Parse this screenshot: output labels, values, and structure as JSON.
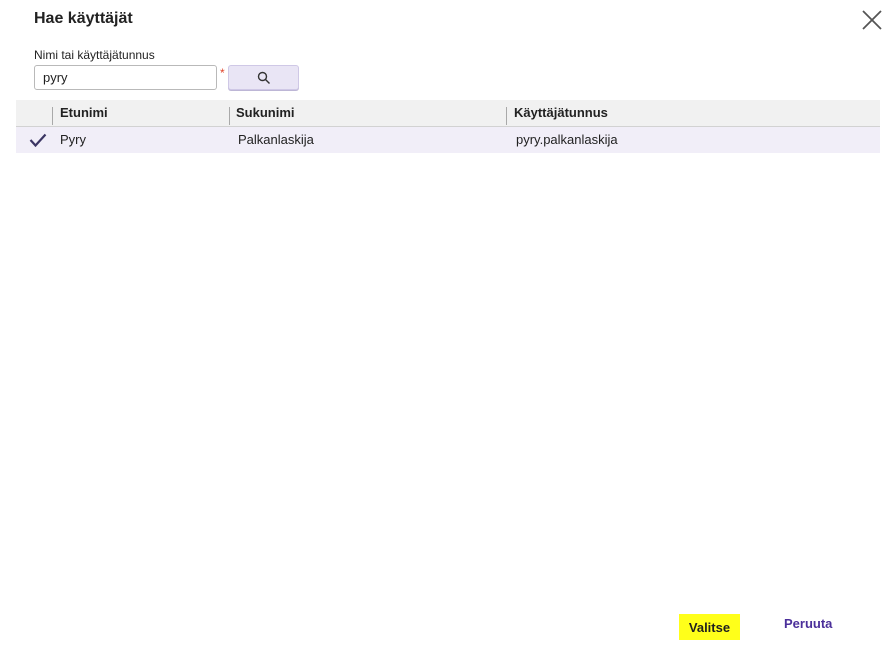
{
  "dialog": {
    "title": "Hae käyttäjät"
  },
  "search": {
    "label": "Nimi tai käyttäjätunnus",
    "value": "pyry",
    "required_mark": "*"
  },
  "table": {
    "columns": [
      "Etunimi",
      "Sukunimi",
      "Käyttäjätunnus"
    ],
    "rows": [
      {
        "selected": true,
        "first_name": "Pyry",
        "last_name": "Palkanlaskija",
        "username": "pyry.palkanlaskija"
      }
    ]
  },
  "footer": {
    "select_label": "Valitse",
    "cancel_label": "Peruuta"
  },
  "icons": {
    "close": "close-icon",
    "search": "search-icon",
    "check": "check-icon"
  },
  "colors": {
    "accent": "#4b2f9a",
    "row_selected_bg": "#f1eef8",
    "header_bg": "#f1f1f1",
    "highlight": "#ffff1a",
    "required": "#e0442a"
  }
}
